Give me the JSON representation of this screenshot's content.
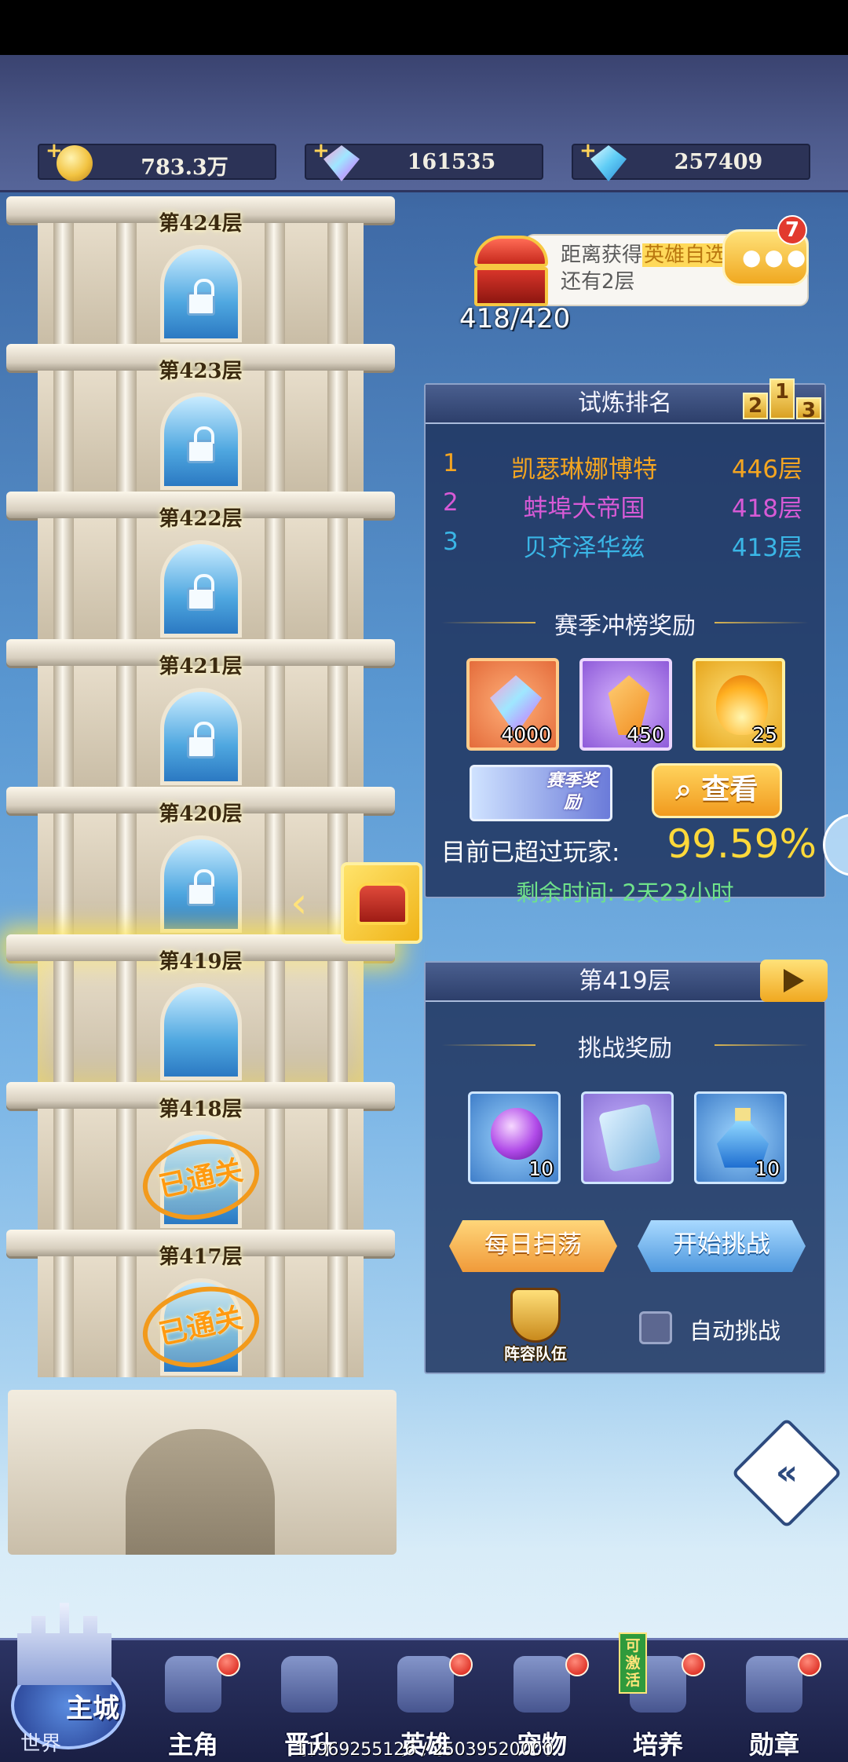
{
  "resources": [
    {
      "icon": "gold-coin-icon",
      "value": "783.3万"
    },
    {
      "icon": "rainbow-diamond-icon",
      "value": "161535"
    },
    {
      "icon": "blue-crystal-icon",
      "value": "257409"
    }
  ],
  "tower": {
    "floors": [
      {
        "label": "第424层",
        "state": "locked"
      },
      {
        "label": "第423层",
        "state": "locked"
      },
      {
        "label": "第422层",
        "state": "locked"
      },
      {
        "label": "第421层",
        "state": "locked"
      },
      {
        "label": "第420层",
        "state": "locked"
      },
      {
        "label": "第419层",
        "state": "current"
      },
      {
        "label": "第418层",
        "state": "cleared",
        "stamp": "已通关"
      },
      {
        "label": "第417层",
        "state": "cleared",
        "stamp": "已通关"
      }
    ]
  },
  "chest_progress": {
    "bubble_prefix": "距离获得",
    "bubble_highlight": "英雄自选金",
    "bubble_suffix": "还有2层",
    "progress": "418/420",
    "chat_badge": "7"
  },
  "ranking": {
    "title": "试炼排名",
    "podium": [
      "2",
      "1",
      "3"
    ],
    "rows": [
      {
        "rank": "1",
        "name": "凯瑟琳娜博特",
        "floor": "446层"
      },
      {
        "rank": "2",
        "name": "蚌埠大帝国",
        "floor": "418层"
      },
      {
        "rank": "3",
        "name": "贝齐泽华兹",
        "floor": "413层"
      }
    ],
    "season_reward_title": "赛季冲榜奖励",
    "rewards": [
      {
        "icon": "rainbow-diamond-icon",
        "count": "4000"
      },
      {
        "icon": "orange-crystal-icon",
        "count": "450"
      },
      {
        "icon": "flame-essence-icon",
        "count": "25"
      }
    ],
    "season_badge": "赛季奖励",
    "view_button": "查看",
    "exceed_label": "目前已超过玩家:",
    "exceed_value": "99.59%",
    "remaining": "剩余时间: 2天23小时"
  },
  "floor_panel": {
    "title": "第419层",
    "challenge_reward_title": "挑战奖励",
    "rewards": [
      {
        "icon": "purple-orb-icon",
        "count": "10"
      },
      {
        "icon": "blue-card-icon",
        "count": ""
      },
      {
        "icon": "blue-potion-icon",
        "count": "10"
      }
    ],
    "sweep_button": "每日扫荡",
    "challenge_button": "开始挑战",
    "team_label": "阵容队伍",
    "auto_label": "自动挑战"
  },
  "nav": {
    "home_main": "主城",
    "home_world": "世界",
    "items": [
      {
        "label": "主角",
        "dot": true
      },
      {
        "label": "晋升",
        "dot": false
      },
      {
        "label": "英雄",
        "dot": true
      },
      {
        "label": "宠物",
        "dot": true
      },
      {
        "label": "培养",
        "dot": true,
        "tag": "可激活"
      },
      {
        "label": "勋章",
        "dot": true
      }
    ]
  },
  "footer_stat": "11969255126 / 25039520000"
}
